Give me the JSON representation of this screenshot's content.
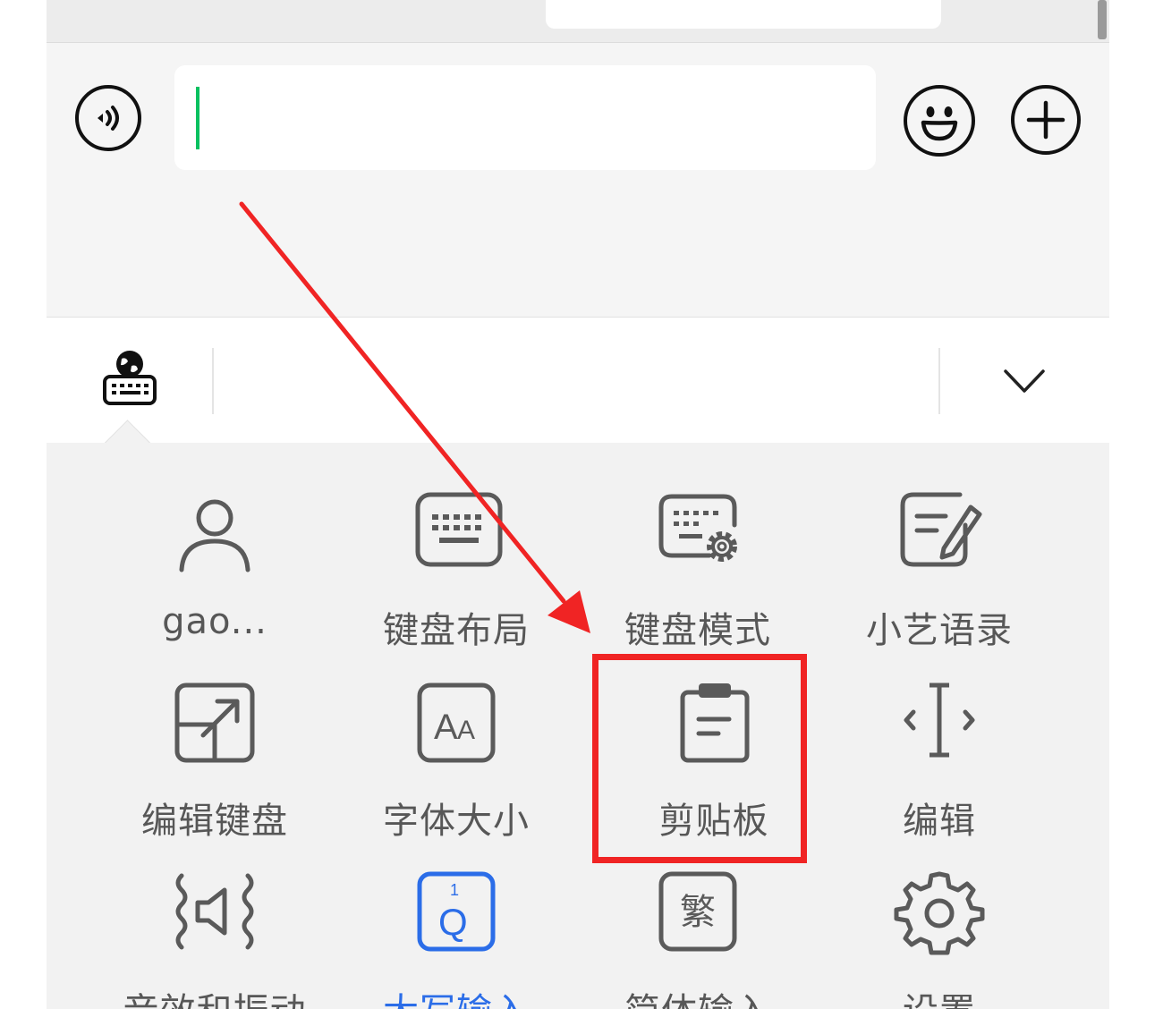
{
  "chat": {},
  "input_bar": {
    "voice_icon": "voice-icon",
    "emoji_icon": "smiley-icon",
    "more_icon": "plus-icon",
    "text_value": "",
    "caret_color": "#07c160"
  },
  "keyboard_toolbar": {
    "left_icon": "keyboard-globe-icon",
    "right_icon": "chevron-down-icon"
  },
  "grid": {
    "items": [
      {
        "label": "gao...",
        "icon": "person-icon"
      },
      {
        "label": "键盘布局",
        "icon": "keyboard-layout-icon"
      },
      {
        "label": "键盘模式",
        "icon": "keyboard-settings-icon"
      },
      {
        "label": "小艺语录",
        "icon": "note-edit-icon"
      },
      {
        "label": "编辑键盘",
        "icon": "edit-keyboard-icon"
      },
      {
        "label": "字体大小",
        "icon": "font-size-icon"
      },
      {
        "label": "剪贴板",
        "icon": "clipboard-icon"
      },
      {
        "label": "编辑",
        "icon": "cursor-edit-icon"
      },
      {
        "label": "音效和振动",
        "icon": "sound-vibration-icon"
      },
      {
        "label": "大写输入",
        "icon": "caps-q-icon"
      },
      {
        "label": "简体输入",
        "icon": "traditional-char-icon",
        "glyph": "繁"
      },
      {
        "label": "设置",
        "icon": "gear-icon"
      }
    ]
  },
  "annotation": {
    "highlight_color": "#f02424",
    "arrow_color": "#f02424"
  }
}
